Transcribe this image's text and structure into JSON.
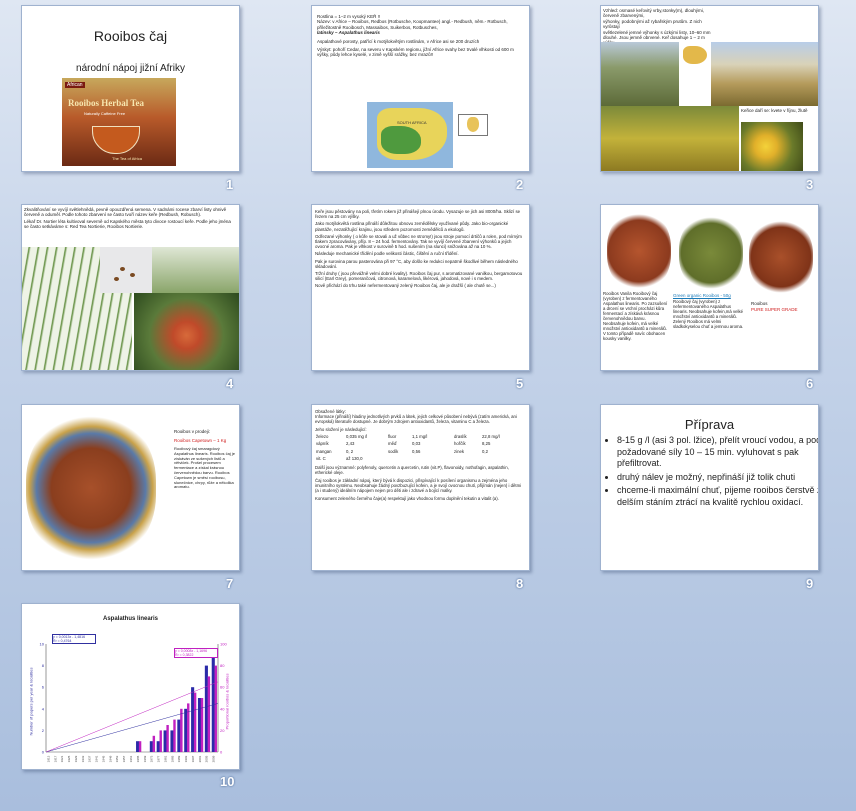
{
  "slides": [
    {
      "number": "1",
      "title": "Rooibos čaj",
      "subtitle": "národní nápoj jižní Afriky",
      "box_text": "Rooibos Herbal Tea",
      "box_sub": "Naturally Caffeine Free",
      "box_brand": "African",
      "box_corner": "The Tea of Africa"
    },
    {
      "number": "2",
      "lines": [
        "Rostlina = 1–2 m vysoký KEŘ !!",
        "Název: v Africe – Rooibos, Redbos (Rotbusche, Koopmantee) angl.- Redbush, něm.- Rotbusch, příležitostně Rooibosch, Massaibos, Suikerbos, Rotbusches,",
        "latinsky – Aspalathus linearis",
        "Aspalathové porosty, patřící k motýlokvětým rostlinám, v Africe asi se 200 druzích",
        "Výskyt: pohoří Cedar, na severu v Kapském regionu, jižní Africe svahy bez trvalé vlhkosti od 600 m výšky, půdy lehce kyselé, v zimě vyšší srážky, bez mrazů!!"
      ],
      "map_label": "SOUTH AFRICA"
    },
    {
      "number": "3",
      "lines": [
        "Vzhled: osmasé keřovitý vrby,stonky(m), dlouhými, červeně zbarvenými,",
        "výhonky, podobnými až rybařským prutům. Z nich vyrůstají",
        "světlezelené jemné výhonky s úzkými listy, 10–60 mm",
        "dlouhé. Jsou jemně obrvené. Keř dosahuje 1 – 2 m výšky."
      ],
      "caption": "Keřice daří se: kvete v říjnu, žlutě"
    },
    {
      "number": "4",
      "lines": [
        "Zkvalitňování se vyvíjí světlehnědá, pevně opouzdřená semena. V sadnámi rocese zbarví listy ohnivě červeně a oduměl. Podle tohoto zbarvení se často tvoří název keře (Redbush, Robusch).",
        "Lékař Dr. Nortier léta kultivoval severně od Kapského města tyto divoce rostoucí keře. Podle jeho jména se často setkáváme s: Red Tea Nortierie, Rooibos Nortierie."
      ]
    },
    {
      "number": "5",
      "lines": [
        "Keře jsou pěstovány na poli, třetím rokem již přinášejí plnou úrodu. Vysazuje se jich asi 8000/ha. Sklizí se řezem na 25 cm výšky.",
        "Jako motýlokvětá rostlina přináší důležitou obnovu zemědělsky využívané půdy. Jako bio-organické plantáže, nezatěžující krajinu, jsou středem pozornosti zemědělců a ekologů.",
        "Odřezané výhonky ( o kůře se stovali a už vůbec ne stromy!) jsou stroje pomocí drtičů a rolen, pod mírným tlakem zpracovávány, příp. 8 – 24 hod. fermentovány. Tak se vyvíjí červené zbarvení výhonků a jejich ovocné aroma. Pak je vlhkost v surovině 5 hod. sušením (na slunci) snižována až na 10 %.",
        "Následuje mechanické třídění podle velikosti částic, čištění a ruční třídění.",
        "Pak je surovina parou pasterována při 97 °C, aby došlo ke redukci nepatrně škodlivé během následného skladování.",
        "Tržní druhy ( jsou převážně velmi dobré kvality). Rooibos čaj pur, s aromatizované vanilkou, bergamotovou silicí (Earl Grey), pomerančová, citronová, karamelová, likérová, jahodová, nové i s medem.",
        "Nově přichází do trhu také nefermentovaný zelený Rooibos čaj, ale je dražší ( ale chutě se...)"
      ]
    },
    {
      "number": "6",
      "col1": "Rooibos Vanila Rooibový čaj (vyroben) z fermentovaného Aspalathus linearis. Po zazsušení a drcení se vrchní procházi kůra fermentací a získává krásnou červenohnědou barvu. Neobsahuje kofein, má velké množství antioxidantů a minerálů. V tomto případě navíc obohacen kousky vanilky.",
      "col2_title": "Green organic Rooibos - 50g",
      "col2": "Rooibový čaj (vyroben) z nefermentovaného Aspalathus linearis. Neobsahuje kofein,má velké množství antioxidantů a minerálů. Zelený Rooibos má velmi sladkokyselou chuť a jemnou aroma.",
      "col3_title": "Rooibos",
      "col3_sub": "PURE SUPER GRADE"
    },
    {
      "number": "7",
      "title": "Rooibos v prodeji:",
      "name": "Rooibos Capetown – 1 Kg",
      "desc": "Rooibový čaj smaragdový Aspalathus linearis. Rooibos čaj je získáván ze sušených listů a větviček. Prošel procesem fermentace a získal krásnou červenohnědou barvu. Rooibos Capetown je směsí rooibosu, slunečnice, chrpy, růže a několika aromatu."
    },
    {
      "number": "8",
      "intro": "Obsažené látky:",
      "p1": "Informace (přináší) hladiny jednotlivých prvků a látek, jejich celkové působení nebývá (zatím americká, ani evropská) literatuře dostupné. Je dobrým zdrojem antioxidantů, železa, vitaminu C a železa.",
      "table_title": "Jeho složení je následující:",
      "rows": [
        [
          "železo",
          "0,035 mg /l",
          "fluor",
          "1,1 mg/l",
          "draslík",
          "22,8 mg/l"
        ],
        [
          "vápník",
          "2,43",
          "měď",
          "0,03",
          "hořčík",
          "8,25"
        ],
        [
          "mangan",
          "0, 2",
          "sodík",
          "0,56",
          "zinek",
          "0,2"
        ],
        [
          "vit. C",
          "až 130,0",
          "",
          "",
          "",
          ""
        ]
      ],
      "p2": "Další jsou významné: polyfenoly, quercetin a quercetin, rutin (vit.P), flavonoidy, nothofagin, aspalathin, etherické oleje.",
      "p3": "Čaj rooibos je základní nápoj, který bývá k dispozici, přispívající k posílení organismu a zejména jeho imunitního systému. Neobsahuje žádný povzbuzující kofein, a je svojí ovocnou chutí, přijímán (nejen) i dětmi (a i studený) ideálním nápojem nejen pro děti ale i zdravé a bojící malky.",
      "p4": "Konsument zeleného černého čaje(a) respektují jako vhodnou formu doplnění tekutin a vitalit (a)."
    },
    {
      "number": "9",
      "title": "Příprava",
      "bullets": [
        "8-15 g /l (asi 3 pol. lžice), přelít vroucí vodou, a podle požadované síly 10 – 15 min. vyluhovat s pak přefiltrovat.",
        "druhý nálev je možný, nepřináší již tolik chuti",
        "chceme-li maximální chuť, pijeme rooibos čerstvě zalitý; delším stáním ztrácí na kvalitě rychlou oxidací."
      ]
    },
    {
      "number": "10",
      "title": "Aspalathus linearis",
      "ylabel_left": "Number of papers per year & localities",
      "ylabel_right": "Proportional rooibos & localities",
      "legend1": "y = 0,0013x - 1,4816\nR² = 0,4764",
      "legend2": "y = 0,0008x - 1,1696\nR² = 0,3822"
    }
  ],
  "chart_data": {
    "type": "bar",
    "title": "Aspalathus linearis",
    "ylabel": "Number of papers per year & localities",
    "ylim": [
      0,
      10
    ],
    "y2lim": [
      0,
      100
    ],
    "y_ticks": [
      "0",
      "2",
      "4",
      "6",
      "8",
      "10"
    ],
    "y2_ticks": [
      "0",
      "20",
      "40",
      "60",
      "80",
      "100"
    ],
    "categories": [
      "1913",
      "1917",
      "1921",
      "1925",
      "1929",
      "1933",
      "1937",
      "1941",
      "1945",
      "1949",
      "1953",
      "1957",
      "1961",
      "1965",
      "1969",
      "1973",
      "1977",
      "1981",
      "1985",
      "1989",
      "1993",
      "1997",
      "2001",
      "2005",
      "2009"
    ],
    "series": [
      {
        "values": [
          0,
          0,
          0,
          0,
          0,
          0,
          0,
          0,
          0,
          0,
          0,
          0,
          0,
          1,
          0,
          1,
          1,
          2,
          2,
          3,
          4,
          6,
          5,
          8,
          9
        ]
      },
      {
        "values": [
          0,
          0,
          0,
          0,
          0,
          0,
          0,
          0,
          0,
          0,
          0,
          0,
          0,
          10,
          0,
          15,
          20,
          25,
          30,
          40,
          45,
          55,
          50,
          70,
          80
        ]
      }
    ]
  }
}
